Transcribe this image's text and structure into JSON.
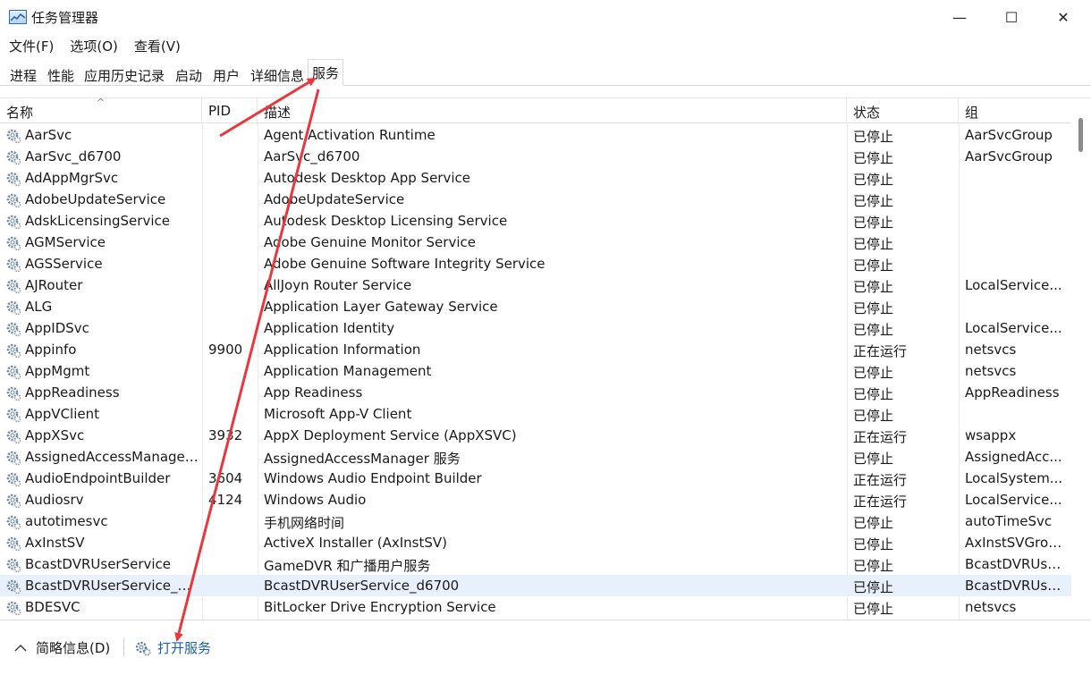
{
  "window": {
    "title": "任务管理器",
    "minimize_glyph": "—",
    "maximize_glyph": "☐",
    "close_glyph": "✕"
  },
  "menu": [
    "文件(F)",
    "选项(O)",
    "查看(V)"
  ],
  "tabs": [
    "进程",
    "性能",
    "应用历史记录",
    "启动",
    "用户",
    "详细信息",
    "服务"
  ],
  "active_tab": "服务",
  "table": {
    "columns": [
      "名称",
      "PID",
      "描述",
      "状态",
      "组"
    ],
    "sort_indicator": "^",
    "rows": [
      {
        "name": "AarSvc",
        "pid": "",
        "desc": "Agent Activation Runtime",
        "status": "已停止",
        "group": "AarSvcGroup"
      },
      {
        "name": "AarSvc_d6700",
        "pid": "",
        "desc": "AarSvc_d6700",
        "status": "已停止",
        "group": "AarSvcGroup"
      },
      {
        "name": "AdAppMgrSvc",
        "pid": "",
        "desc": "Autodesk Desktop App Service",
        "status": "已停止",
        "group": ""
      },
      {
        "name": "AdobeUpdateService",
        "pid": "",
        "desc": "AdobeUpdateService",
        "status": "已停止",
        "group": ""
      },
      {
        "name": "AdskLicensingService",
        "pid": "",
        "desc": "Autodesk Desktop Licensing Service",
        "status": "已停止",
        "group": ""
      },
      {
        "name": "AGMService",
        "pid": "",
        "desc": "Adobe Genuine Monitor Service",
        "status": "已停止",
        "group": ""
      },
      {
        "name": "AGSService",
        "pid": "",
        "desc": "Adobe Genuine Software Integrity Service",
        "status": "已停止",
        "group": ""
      },
      {
        "name": "AJRouter",
        "pid": "",
        "desc": "AllJoyn Router Service",
        "status": "已停止",
        "group": "LocalService..."
      },
      {
        "name": "ALG",
        "pid": "",
        "desc": "Application Layer Gateway Service",
        "status": "已停止",
        "group": ""
      },
      {
        "name": "AppIDSvc",
        "pid": "",
        "desc": "Application Identity",
        "status": "已停止",
        "group": "LocalService..."
      },
      {
        "name": "Appinfo",
        "pid": "9900",
        "desc": "Application Information",
        "status": "正在运行",
        "group": "netsvcs"
      },
      {
        "name": "AppMgmt",
        "pid": "",
        "desc": "Application Management",
        "status": "已停止",
        "group": "netsvcs"
      },
      {
        "name": "AppReadiness",
        "pid": "",
        "desc": "App Readiness",
        "status": "已停止",
        "group": "AppReadiness"
      },
      {
        "name": "AppVClient",
        "pid": "",
        "desc": "Microsoft App-V Client",
        "status": "已停止",
        "group": ""
      },
      {
        "name": "AppXSvc",
        "pid": "3932",
        "desc": "AppX Deployment Service (AppXSVC)",
        "status": "正在运行",
        "group": "wsappx"
      },
      {
        "name": "AssignedAccessManager...",
        "pid": "",
        "desc": "AssignedAccessManager 服务",
        "status": "已停止",
        "group": "AssignedAcc..."
      },
      {
        "name": "AudioEndpointBuilder",
        "pid": "3604",
        "desc": "Windows Audio Endpoint Builder",
        "status": "正在运行",
        "group": "LocalSystem..."
      },
      {
        "name": "Audiosrv",
        "pid": "4124",
        "desc": "Windows Audio",
        "status": "正在运行",
        "group": "LocalService..."
      },
      {
        "name": "autotimesvc",
        "pid": "",
        "desc": "手机网络时间",
        "status": "已停止",
        "group": "autoTimeSvc"
      },
      {
        "name": "AxInstSV",
        "pid": "",
        "desc": "ActiveX Installer (AxInstSV)",
        "status": "已停止",
        "group": "AxInstSVGroup"
      },
      {
        "name": "BcastDVRUserService",
        "pid": "",
        "desc": "GameDVR 和广播用户服务",
        "status": "已停止",
        "group": "BcastDVRUse..."
      },
      {
        "name": "BcastDVRUserService_d6...",
        "pid": "",
        "desc": "BcastDVRUserService_d6700",
        "status": "已停止",
        "group": "BcastDVRUse..."
      },
      {
        "name": "BDESVC",
        "pid": "",
        "desc": "BitLocker Drive Encryption Service",
        "status": "已停止",
        "group": "netsvcs"
      }
    ],
    "selected_row": "BcastDVRUserService_d6..."
  },
  "footer": {
    "fewer_details": "简略信息(D)",
    "open_services": "打开服务"
  },
  "colors": {
    "annotation_arrow": "#e8383d",
    "link": "#1a5fb4",
    "selected_row": "#e8f1fb"
  },
  "icons": [
    "gear-icon",
    "task-manager-icon",
    "chevron-up-icon",
    "services-icon"
  ]
}
